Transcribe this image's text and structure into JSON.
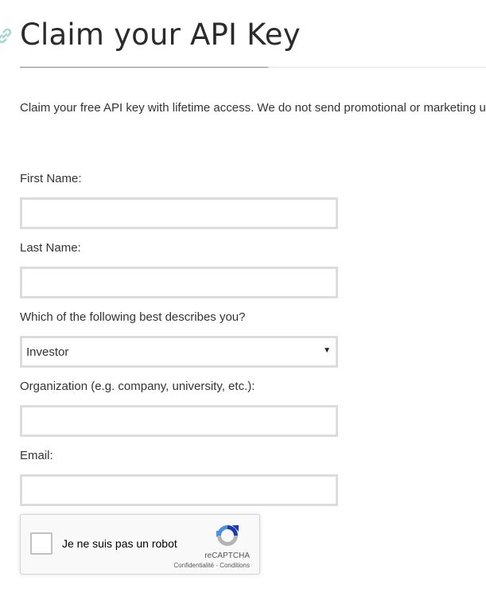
{
  "page": {
    "title": "Claim your API Key",
    "intro": "Claim your free API key with lifetime access. We do not send promotional or marketing updates."
  },
  "form": {
    "first_name_label": "First Name:",
    "first_name_value": "",
    "last_name_label": "Last Name:",
    "last_name_value": "",
    "describes_label": "Which of the following best describes you?",
    "describes_selected": "Investor",
    "organization_label": "Organization (e.g. company, university, etc.):",
    "organization_value": "",
    "email_label": "Email:",
    "email_value": ""
  },
  "recaptcha": {
    "label": "Je ne suis pas un robot",
    "brand": "reCAPTCHA",
    "links": "Confidentialité - Conditions",
    "checked": false
  },
  "icons": {
    "anchor": "link-icon",
    "select_arrow": "caret-down-icon",
    "recaptcha_logo": "recaptcha-logo-icon"
  },
  "colors": {
    "input_border": "#dcdcdc",
    "anchor_icon": "#9fd6cf",
    "recaptcha_blue": "#4a90e2",
    "recaptcha_gray": "#b4b4b4"
  }
}
